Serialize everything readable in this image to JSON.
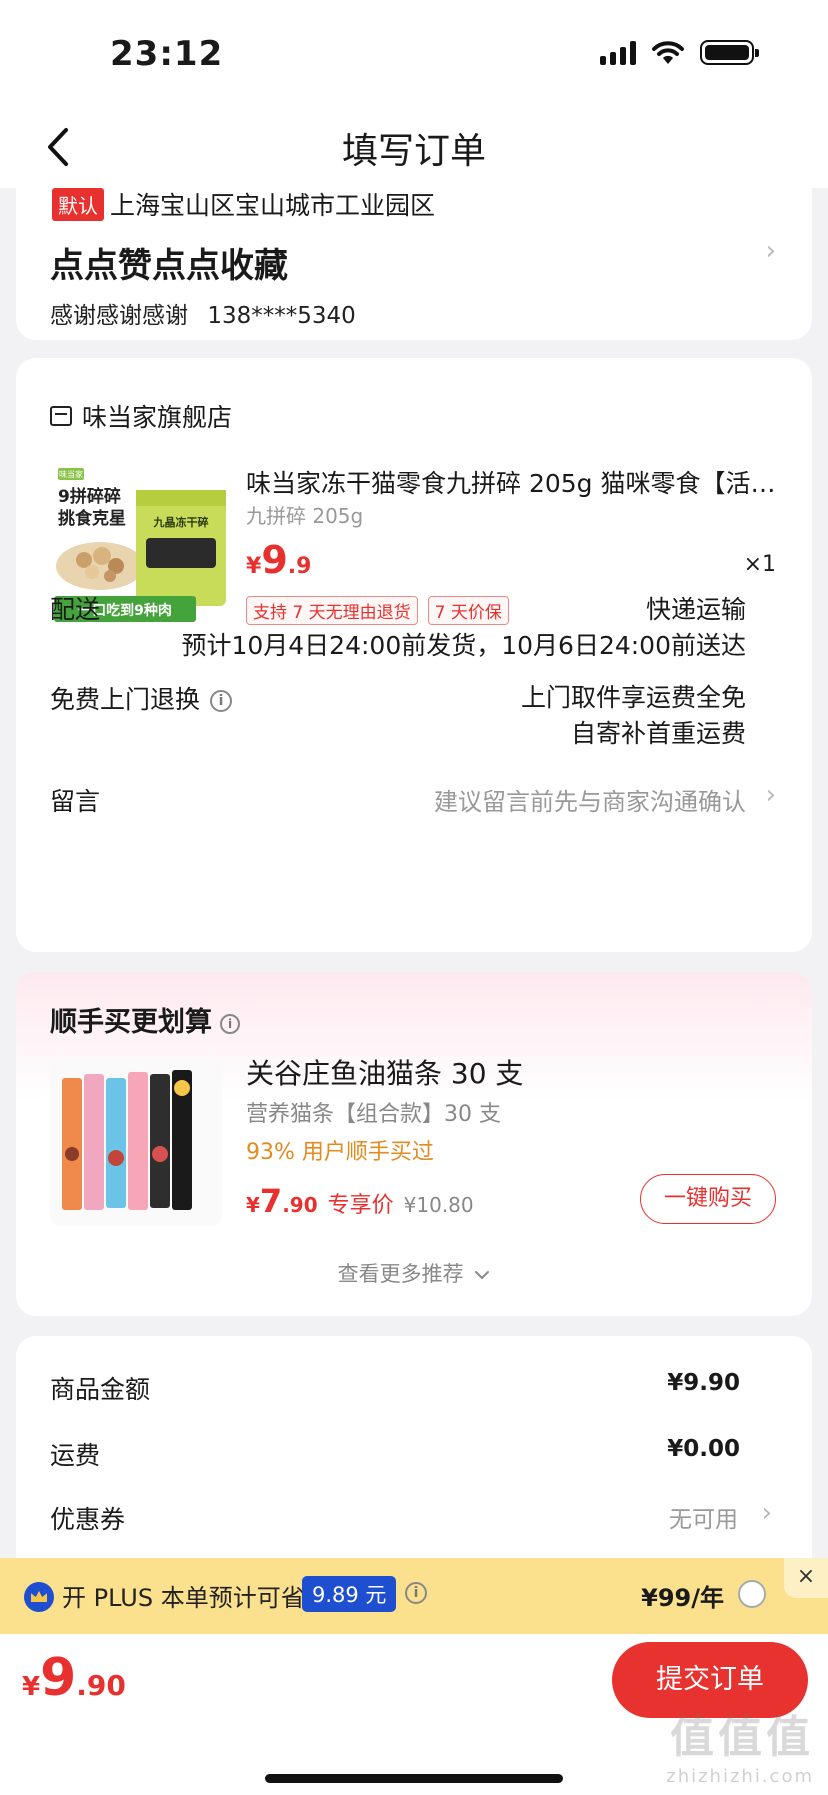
{
  "status_bar": {
    "time": "23:12"
  },
  "header": {
    "title": "填写订单"
  },
  "address": {
    "default_tag": "默认",
    "region": "上海宝山区宝山城市工业园区",
    "detail": "点点赞点点收藏",
    "contact_name": "感谢感谢感谢",
    "phone": "138****5340"
  },
  "store": {
    "name": "味当家旗舰店",
    "product": {
      "name": "味当家冻干猫零食九拼碎 205g 猫咪零食【活…",
      "spec": "九拼碎 205g",
      "price_symbol": "¥",
      "price_int": "9",
      "price_dec": ".9",
      "qty": "×1",
      "tags": [
        "支持 7 天无理由退货",
        "7 天价保"
      ],
      "image_texts": {
        "brand": "味当家",
        "line1": "9拼碎碎",
        "line2": "挑食克星",
        "bag": "九晶冻干碎",
        "banner": "一口吃到9种肉"
      }
    },
    "delivery": {
      "label": "配送",
      "method": "快递运输",
      "eta": "预计10月4日24:00前发货，10月6日24:00前送达"
    },
    "return": {
      "label": "免费上门退换",
      "line1": "上门取件享运费全免",
      "line2": "自寄补首重运费"
    },
    "message": {
      "label": "留言",
      "placeholder": "建议留言前先与商家沟通确认"
    }
  },
  "recommend": {
    "title": "顺手买更划算",
    "item": {
      "name": "关谷庄鱼油猫条 30 支",
      "spec": "营养猫条【组合款】30 支",
      "stat": "93% 用户顺手买过",
      "price_symbol": "¥",
      "price_int": "7",
      "price_dec": ".90",
      "exclusive": "专享价",
      "original": "¥10.80",
      "buy_label": "一键购买"
    },
    "more": "查看更多推荐"
  },
  "fees": {
    "goods_label": "商品金额",
    "goods_value": "¥9.90",
    "shipping_label": "运费",
    "shipping_value": "¥0.00",
    "coupon_label": "优惠券",
    "coupon_value": "无可用"
  },
  "plus": {
    "text": "开 PLUS 本单预计可省",
    "save": "9.89 元",
    "price": "¥99/年",
    "close": "×"
  },
  "bottom": {
    "total_symbol": "¥",
    "total_int": "9",
    "total_dec": ".90",
    "submit_label": "提交订单",
    "watermark": "值值值",
    "watermark_sub": "zhizhizhi.com"
  },
  "colors": {
    "accent": "#e8312f",
    "plus_bg": "#fbe08d",
    "plus_blue": "#1f4fd1",
    "stat_orange": "#e58a1f"
  }
}
